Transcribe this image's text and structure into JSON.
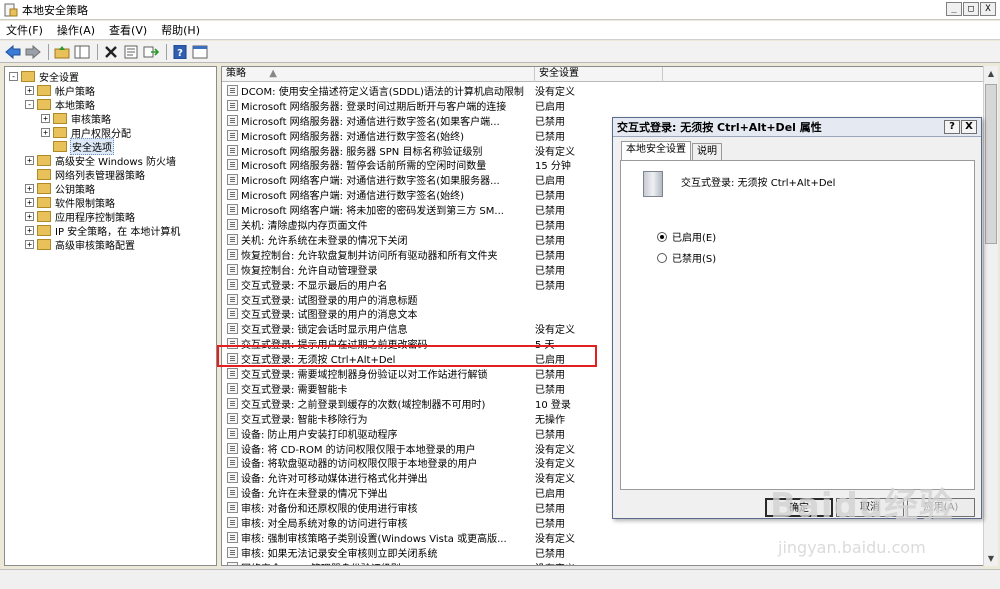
{
  "window": {
    "title": "本地安全策略",
    "buttons": [
      "_",
      "□",
      "X"
    ]
  },
  "menu": [
    "文件(F)",
    "操作(A)",
    "查看(V)",
    "帮助(H)"
  ],
  "toolbar": [
    "back-icon",
    "forward-icon",
    "up-folder-icon",
    "show-hide-tree-icon",
    "delete-icon",
    "properties-icon",
    "export-icon",
    "help-icon",
    "console-icon"
  ],
  "tree": [
    {
      "label": "安全设置",
      "level": 0,
      "expander": "-",
      "icon": "security-settings-icon"
    },
    {
      "label": "帐户策略",
      "level": 1,
      "expander": "+",
      "icon": "folder-icon"
    },
    {
      "label": "本地策略",
      "level": 1,
      "expander": "-",
      "icon": "folder-icon"
    },
    {
      "label": "审核策略",
      "level": 2,
      "expander": "+",
      "icon": "folder-icon"
    },
    {
      "label": "用户权限分配",
      "level": 2,
      "expander": "+",
      "icon": "folder-icon"
    },
    {
      "label": "安全选项",
      "level": 2,
      "expander": "",
      "icon": "folder-icon",
      "selected": true
    },
    {
      "label": "高级安全 Windows 防火墙",
      "level": 1,
      "expander": "+",
      "icon": "folder-icon"
    },
    {
      "label": "网络列表管理器策略",
      "level": 1,
      "expander": "",
      "icon": "folder-icon"
    },
    {
      "label": "公钥策略",
      "level": 1,
      "expander": "+",
      "icon": "folder-icon"
    },
    {
      "label": "软件限制策略",
      "level": 1,
      "expander": "+",
      "icon": "folder-icon"
    },
    {
      "label": "应用程序控制策略",
      "level": 1,
      "expander": "+",
      "icon": "folder-icon"
    },
    {
      "label": "IP 安全策略，在 本地计算机",
      "level": 1,
      "expander": "+",
      "icon": "ip-security-icon"
    },
    {
      "label": "高级审核策略配置",
      "level": 1,
      "expander": "+",
      "icon": "folder-icon"
    }
  ],
  "list": {
    "columns": [
      "策略",
      "安全设置"
    ],
    "sort_indicator": "▲",
    "rows": [
      {
        "policy": "DCOM: 使用安全描述符定义语言(SDDL)语法的计算机启动限制",
        "setting": "没有定义"
      },
      {
        "policy": "Microsoft 网络服务器: 登录时间过期后断开与客户端的连接",
        "setting": "已启用"
      },
      {
        "policy": "Microsoft 网络服务器: 对通信进行数字签名(如果客户端...",
        "setting": "已禁用"
      },
      {
        "policy": "Microsoft 网络服务器: 对通信进行数字签名(始终)",
        "setting": "已禁用"
      },
      {
        "policy": "Microsoft 网络服务器: 服务器 SPN 目标名称验证级别",
        "setting": "没有定义"
      },
      {
        "policy": "Microsoft 网络服务器: 暂停会话前所需的空闲时间数量",
        "setting": "15 分钟"
      },
      {
        "policy": "Microsoft 网络客户端: 对通信进行数字签名(如果服务器...",
        "setting": "已启用"
      },
      {
        "policy": "Microsoft 网络客户端: 对通信进行数字签名(始终)",
        "setting": "已禁用"
      },
      {
        "policy": "Microsoft 网络客户端: 将未加密的密码发送到第三方 SM...",
        "setting": "已禁用"
      },
      {
        "policy": "关机: 清除虚拟内存页面文件",
        "setting": "已禁用"
      },
      {
        "policy": "关机: 允许系统在未登录的情况下关闭",
        "setting": "已禁用"
      },
      {
        "policy": "恢复控制台: 允许软盘复制并访问所有驱动器和所有文件夹",
        "setting": "已禁用"
      },
      {
        "policy": "恢复控制台: 允许自动管理登录",
        "setting": "已禁用"
      },
      {
        "policy": "交互式登录: 不显示最后的用户名",
        "setting": "已禁用"
      },
      {
        "policy": "交互式登录: 试图登录的用户的消息标题",
        "setting": ""
      },
      {
        "policy": "交互式登录: 试图登录的用户的消息文本",
        "setting": ""
      },
      {
        "policy": "交互式登录: 锁定会话时显示用户信息",
        "setting": "没有定义"
      },
      {
        "policy": "交互式登录: 提示用户在过期之前更改密码",
        "setting": "5 天"
      },
      {
        "policy": "交互式登录: 无须按 Ctrl+Alt+Del",
        "setting": "已启用"
      },
      {
        "policy": "交互式登录: 需要域控制器身份验证以对工作站进行解锁",
        "setting": "已禁用"
      },
      {
        "policy": "交互式登录: 需要智能卡",
        "setting": "已禁用"
      },
      {
        "policy": "交互式登录: 之前登录到缓存的次数(域控制器不可用时)",
        "setting": "10 登录"
      },
      {
        "policy": "交互式登录: 智能卡移除行为",
        "setting": "无操作"
      },
      {
        "policy": "设备: 防止用户安装打印机驱动程序",
        "setting": "已禁用"
      },
      {
        "policy": "设备: 将 CD-ROM 的访问权限仅限于本地登录的用户",
        "setting": "没有定义"
      },
      {
        "policy": "设备: 将软盘驱动器的访问权限仅限于本地登录的用户",
        "setting": "没有定义"
      },
      {
        "policy": "设备: 允许对可移动媒体进行格式化并弹出",
        "setting": "没有定义"
      },
      {
        "policy": "设备: 允许在未登录的情况下弹出",
        "setting": "已启用"
      },
      {
        "policy": "审核: 对备份和还原权限的使用进行审核",
        "setting": "已禁用"
      },
      {
        "policy": "审核: 对全局系统对象的访问进行审核",
        "setting": "已禁用"
      },
      {
        "policy": "审核: 强制审核策略子类别设置(Windows Vista 或更高版...",
        "setting": "没有定义"
      },
      {
        "policy": "审核: 如果无法记录安全审核则立即关闭系统",
        "setting": "已禁用"
      },
      {
        "policy": "网络安全: LAN 管理器身份验证级别",
        "setting": "没有定义"
      }
    ],
    "highlighted_row": 18
  },
  "dialog": {
    "title": "交互式登录: 无须按 Ctrl+Alt+Del 属性",
    "title_buttons": [
      "?",
      "X"
    ],
    "tabs": [
      "本地安全设置",
      "说明"
    ],
    "policy_name": "交互式登录: 无须按 Ctrl+Alt+Del",
    "options": [
      {
        "label": "已启用(E)",
        "selected": true
      },
      {
        "label": "已禁用(S)",
        "selected": false
      }
    ],
    "buttons": {
      "ok": "确定",
      "cancel": "取消",
      "apply": "应用(A)"
    }
  },
  "watermark": {
    "logo": "Baidu经验",
    "site": "jingyan.baidu.com"
  }
}
